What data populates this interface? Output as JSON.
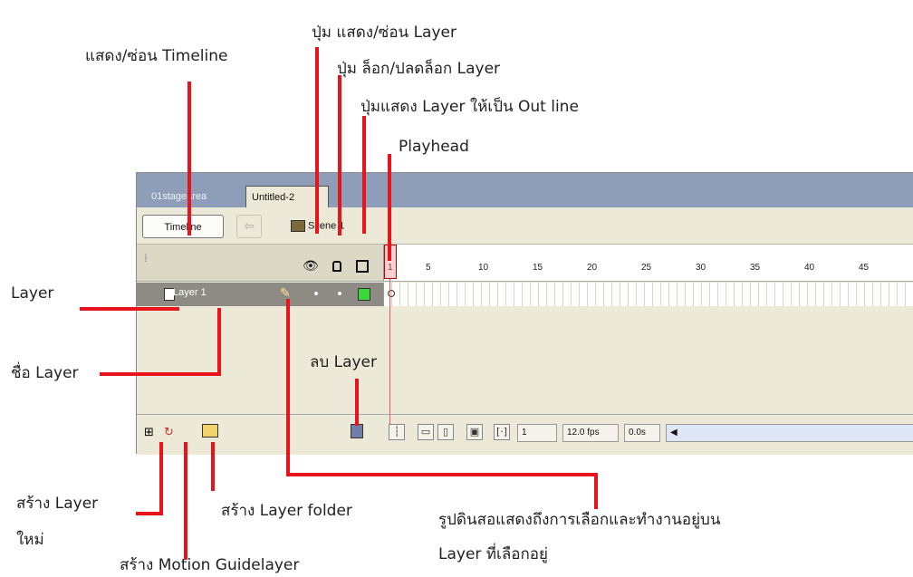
{
  "panel": {
    "tabs": [
      "01stagearea",
      "Untitled-2"
    ],
    "timeline_button": "Timeline",
    "scene_label": "Scene 1",
    "frame_ticks": [
      "1",
      "5",
      "10",
      "15",
      "20",
      "25",
      "30",
      "35",
      "40",
      "45"
    ],
    "layer_name": "Layer 1",
    "current_frame": "1",
    "fps": "12.0 fps",
    "elapsed": "0.0s"
  },
  "annotations": {
    "show_hide_timeline": "แสดง/ซ่อน Timeline",
    "show_hide_layer_btn": "ปุ่ม แสดง/ซ่อน Layer",
    "lock_unlock_layer_btn": "ปุ่ม ล็อก/ปลดล็อก Layer",
    "outline_layer_btn": "ปุ่มแสดง Layer ให้เป็น Out line",
    "playhead": "Playhead",
    "layer": "Layer",
    "layer_name": "ชื่อ Layer",
    "delete_layer": "ลบ Layer",
    "new_layer_1": "สร้าง Layer",
    "new_layer_2": "ใหม่",
    "new_layer_folder": "สร้าง Layer folder",
    "motion_guide": "สร้าง Motion Guidelayer",
    "pencil_desc_1": "รูปดินสอแสดงถึงการเลือกและทำงานอยู่บน",
    "pencil_desc_2": "Layer ที่เลือกอยู่"
  },
  "colors": {
    "annotation_line": "#e8141c",
    "outline_square": "#3ad63a",
    "tab_bar": "#8e9eb8"
  }
}
